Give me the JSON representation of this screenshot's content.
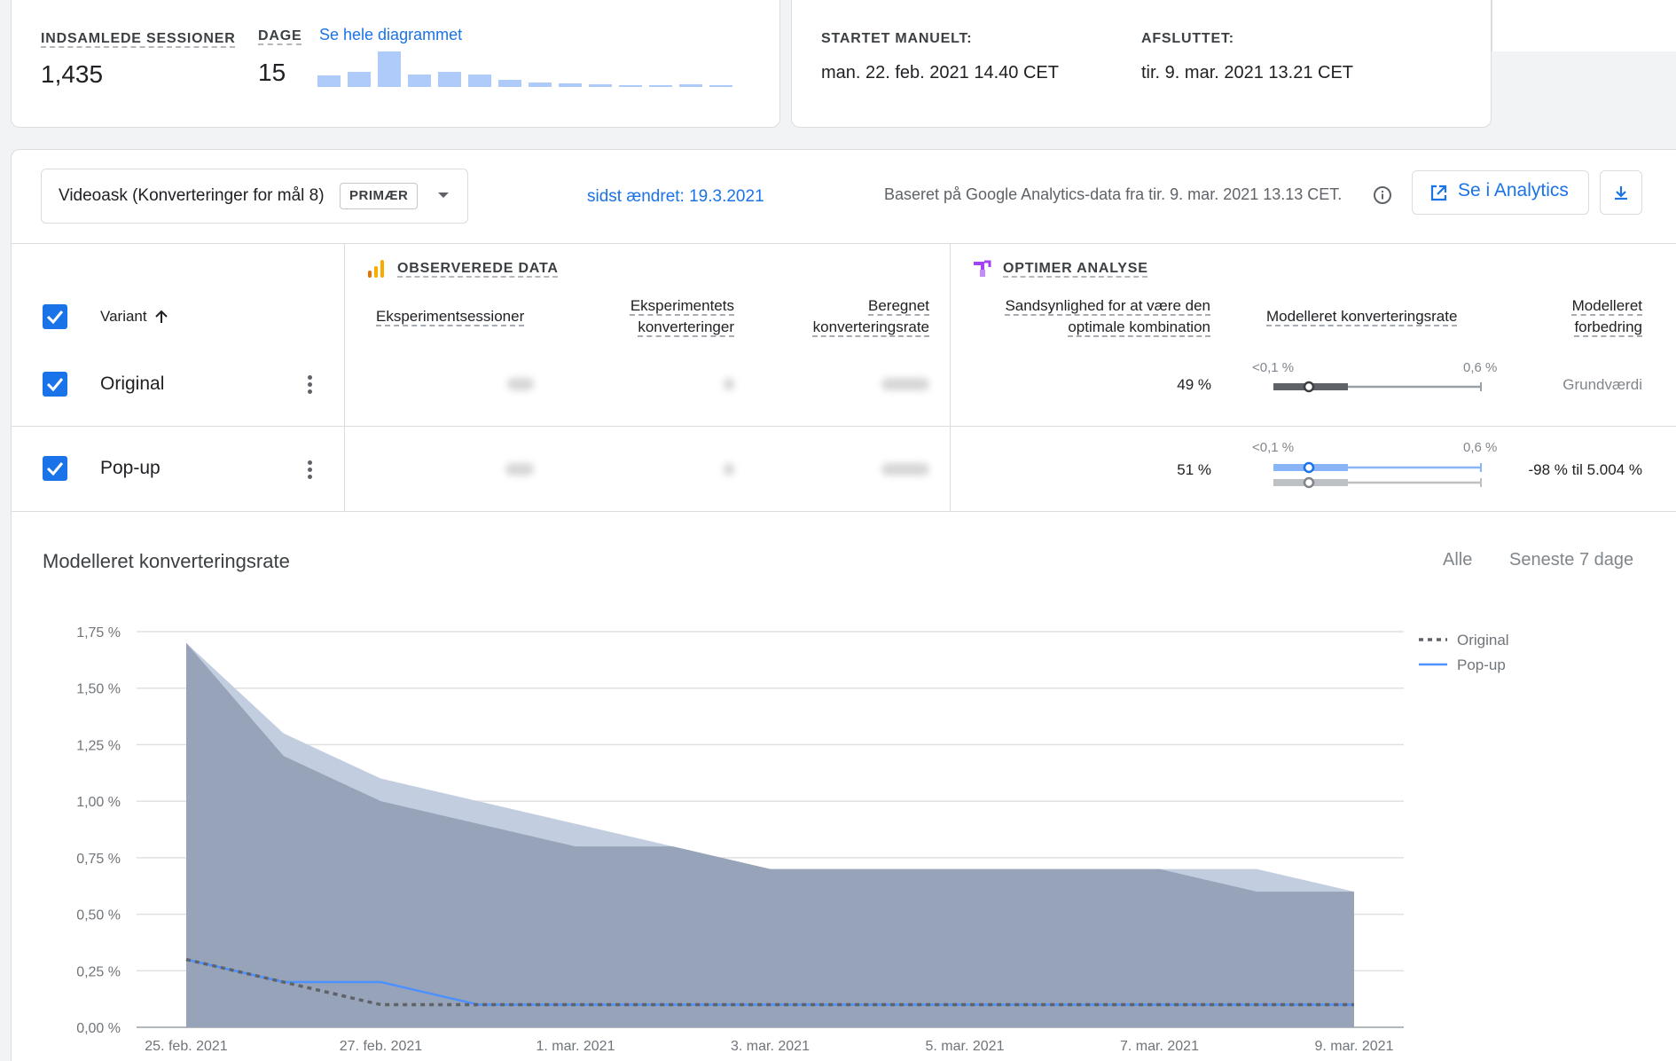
{
  "summary": {
    "sessions_label": "INDSAMLEDE SESSIONER",
    "sessions_value": "1,435",
    "days_label": "DAGE",
    "days_value": "15",
    "full_chart_link": "Se hele diagrammet",
    "mini_bars": [
      0.32,
      0.42,
      1.0,
      0.36,
      0.42,
      0.36,
      0.2,
      0.12,
      0.1,
      0.07,
      0.06,
      0.06,
      0.07,
      0.06
    ],
    "started_label": "STARTET MANUELT:",
    "started_value": "man. 22. feb. 2021 14.40 CET",
    "ended_label": "AFSLUTTET:",
    "ended_value": "tir. 9. mar. 2021 13.21 CET"
  },
  "toolbar": {
    "goal_select_value": "Videoask (Konverteringer for mål 8)",
    "primary_chip": "PRIMÆR",
    "last_changed": "sidst ændret: 19.3.2021",
    "data_basis": "Baseret på Google Analytics-data fra tir. 9. mar. 2021 13.13 CET.",
    "analytics_button": "Se i Analytics"
  },
  "table": {
    "observed_section": "OBSERVEREDE DATA",
    "optimize_section": "OPTIMER ANALYSE",
    "headers": {
      "variant": "Variant",
      "sessions": "Eksperimentsessioner",
      "conversions_1": "Eksperimentets",
      "conversions_2": "konverteringer",
      "rate_1": "Beregnet",
      "rate_2": "konverteringsrate",
      "prob_1": "Sandsynlighed for at være den",
      "prob_2": "optimale kombination",
      "modeled_rate": "Modelleret konverteringsrate",
      "improvement_1": "Modelleret",
      "improvement_2": "forbedring"
    },
    "rows": [
      {
        "name": "Original",
        "probability": "49 %",
        "range_min": "<0,1 %",
        "range_max": "0,6 %",
        "improvement": "Grundværdi"
      },
      {
        "name": "Pop-up",
        "probability": "51 %",
        "range_min": "<0,1 %",
        "range_max": "0,6 %",
        "improvement": "-98 % til 5.004 %"
      }
    ]
  },
  "chart_section": {
    "title": "Modelleret konverteringsrate",
    "tab_all": "Alle",
    "tab_7days": "Seneste 7 dage"
  },
  "colors": {
    "accent": "#1a73e8",
    "original_band": "#97a3b9",
    "popup_band": "#c3cde0",
    "original_line": "#5f6368",
    "popup_line": "#4d90fe",
    "analytics_orange": "#f9ab00",
    "optimize_purple": "#a142f4"
  },
  "icons": {
    "analytics": "analytics-bars-icon",
    "optimize": "optimize-icon",
    "info": "info-icon",
    "open_external": "open-in-new-icon",
    "download": "download-icon",
    "dropdown": "dropdown-arrow-icon",
    "sort": "sort-arrow-up-icon",
    "more": "more-vert-icon",
    "check": "check-icon"
  },
  "chart_data": {
    "type": "area",
    "title": "Modelleret konverteringsrate",
    "x": [
      "25. feb. 2021",
      "26. feb. 2021",
      "27. feb. 2021",
      "28. feb. 2021",
      "1. mar. 2021",
      "2. mar. 2021",
      "3. mar. 2021",
      "4. mar. 2021",
      "5. mar. 2021",
      "6. mar. 2021",
      "7. mar. 2021",
      "8. mar. 2021",
      "9. mar. 2021"
    ],
    "x_tick_labels": [
      "25. feb. 2021",
      "27. feb. 2021",
      "1. mar. 2021",
      "3. mar. 2021",
      "5. mar. 2021",
      "7. mar. 2021",
      "9. mar. 2021"
    ],
    "y_tick_labels": [
      "0,00 %",
      "0,25 %",
      "0,50 %",
      "0,75 %",
      "1,00 %",
      "1,25 %",
      "1,50 %",
      "1,75 %"
    ],
    "ylim": [
      0,
      1.75
    ],
    "y_unit": "%",
    "grid": true,
    "legend_position": "top-right",
    "series": [
      {
        "name": "Original",
        "style": "dashed",
        "values": [
          0.3,
          0.2,
          0.1,
          0.1,
          0.1,
          0.1,
          0.1,
          0.1,
          0.1,
          0.1,
          0.1,
          0.1,
          0.1
        ],
        "band_upper": [
          1.7,
          1.2,
          1.0,
          0.9,
          0.8,
          0.8,
          0.7,
          0.7,
          0.7,
          0.7,
          0.7,
          0.6,
          0.6
        ]
      },
      {
        "name": "Pop-up",
        "style": "solid",
        "values": [
          0.3,
          0.2,
          0.2,
          0.1,
          0.1,
          0.1,
          0.1,
          0.1,
          0.1,
          0.1,
          0.1,
          0.1,
          0.1
        ],
        "band_upper": [
          1.7,
          1.3,
          1.1,
          1.0,
          0.9,
          0.8,
          0.7,
          0.7,
          0.7,
          0.7,
          0.7,
          0.7,
          0.6
        ]
      }
    ]
  }
}
